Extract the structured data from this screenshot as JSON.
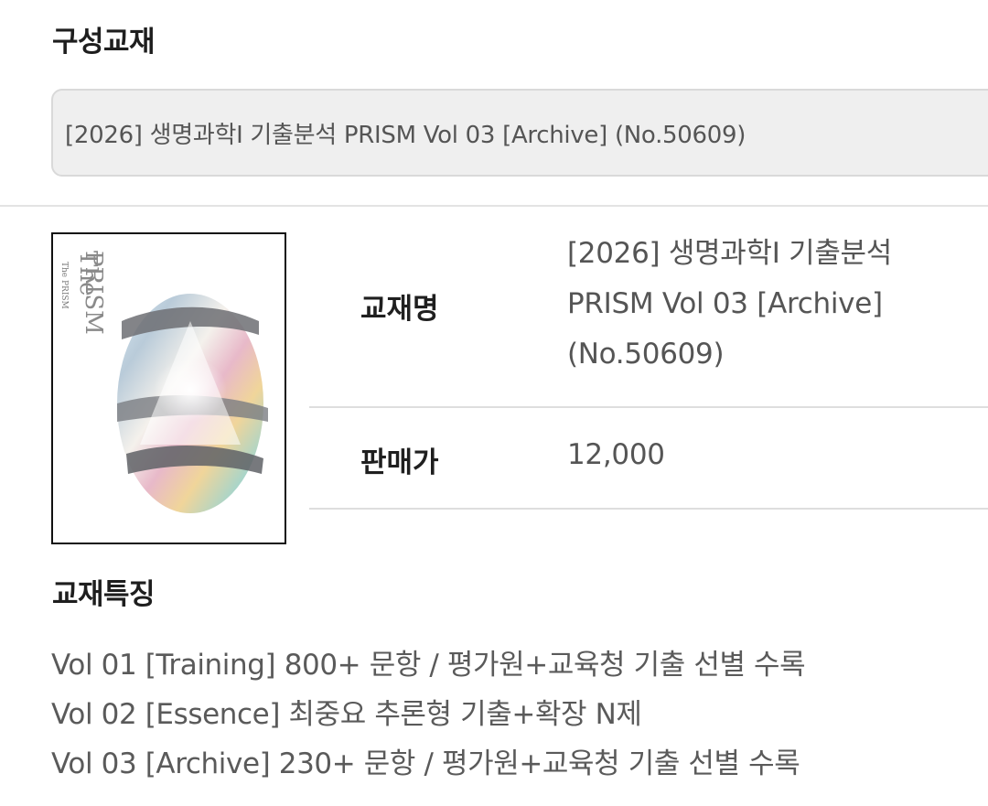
{
  "composition": {
    "title": "구성교재",
    "selected_option": "[2026] 생명과학I 기출분석 PRISM Vol 03 [Archive] (No.50609)"
  },
  "book": {
    "cover_title_line1": "The",
    "cover_title_line2": "PRISM",
    "cover_small_text": "The PRISM",
    "name_label": "교재명",
    "name_line1": "[2026] 생명과학I 기출분석",
    "name_line2": "PRISM Vol 03 [Archive]",
    "name_line3": "(No.50609)",
    "price_label": "판매가",
    "price_value": "12,000"
  },
  "features": {
    "title": "교재특징",
    "items": [
      "Vol 01 [Training] 800+ 문항 / 평가원+교육청 기출 선별 수록",
      "Vol 02 [Essence] 최중요 추론형 기출+확장 N제",
      "Vol 03 [Archive] 230+ 문항 / 평가원+교육청 기출 선별 수록"
    ]
  },
  "colors": {
    "select_bg": "#efefef",
    "select_border": "#d9d9d9",
    "divider": "#dedede",
    "label_text": "#1f1f1f",
    "value_text": "#555555"
  }
}
